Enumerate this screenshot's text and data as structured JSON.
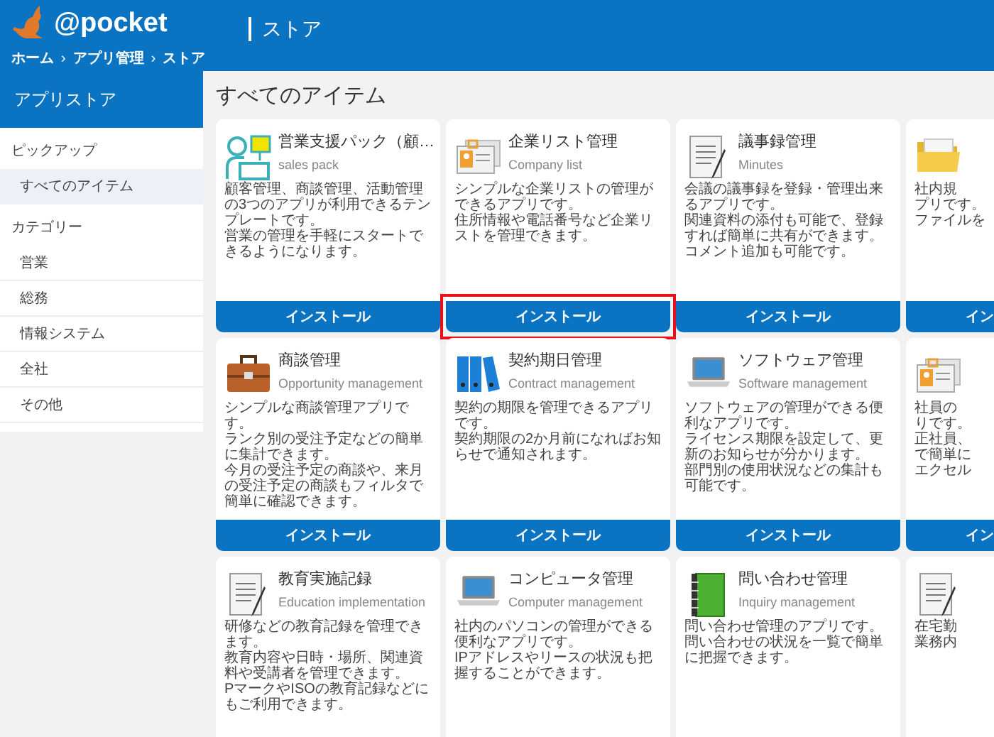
{
  "header": {
    "logo": "@pocket",
    "title": "ストア",
    "breadcrumb": [
      "ホーム",
      "›",
      "アプリ管理",
      "›",
      "ストア"
    ]
  },
  "sidebar": {
    "title": "アプリストア",
    "sections": [
      {
        "heading": "ピックアップ",
        "items": [
          {
            "label": "すべてのアイテム",
            "selected": true
          }
        ]
      },
      {
        "heading": "カテゴリー",
        "items": [
          {
            "label": "営業",
            "selected": false
          },
          {
            "label": "総務",
            "selected": false
          },
          {
            "label": "情報システム",
            "selected": false
          },
          {
            "label": "全社",
            "selected": false
          },
          {
            "label": "その他",
            "selected": false
          }
        ]
      }
    ]
  },
  "main": {
    "title": "すべてのアイテム",
    "cards": [
      {
        "title": "営業支援パック（顧…",
        "subtitle": "sales pack",
        "description": [
          "顧客管理、商談管理、活動管理の3つのアプリが利用できるテンプレートです。",
          "営業の管理を手軽にスタートできるようになります。"
        ],
        "button": {
          "label": "インストール",
          "highlighted": false
        }
      },
      {
        "title": "企業リスト管理",
        "subtitle": "Company list",
        "description": [
          "シンプルな企業リストの管理ができるアプリです。",
          "住所情報や電話番号など企業リストを管理できます。"
        ],
        "button": {
          "label": "インストール",
          "highlighted": true
        }
      },
      {
        "title": "議事録管理",
        "subtitle": "Minutes",
        "description": [
          "会議の議事録を登録・管理出来るアプリです。",
          "関連資料の添付も可能で、登録すれば簡単に共有ができます。",
          "コメント追加も可能です。"
        ],
        "button": {
          "label": "インストール",
          "highlighted": false
        }
      },
      {
        "description": [
          "社内規",
          "プリです。",
          "ファイルを"
        ],
        "button": {
          "label": "イン",
          "highlighted": false
        }
      },
      {
        "title": "商談管理",
        "subtitle": "Opportunity management",
        "description": [
          "シンプルな商談管理アプリです。",
          "ランク別の受注予定などの簡単に集計できます。",
          "今月の受注予定の商談や、来月の受注予定の商談もフィルタで簡単に確認できます。"
        ],
        "button": {
          "label": "インストール",
          "highlighted": false
        }
      },
      {
        "title": "契約期日管理",
        "subtitle": "Contract management",
        "description": [
          "契約の期限を管理できるアプリです。",
          "契約期限の2か月前になればお知らせで通知されます。"
        ],
        "button": {
          "label": "インストール",
          "highlighted": false
        }
      },
      {
        "title": "ソフトウェア管理",
        "subtitle": "Software management",
        "description": [
          "ソフトウェアの管理ができる便利なアプリです。",
          "ライセンス期限を設定して、更新のお知らせが分かります。",
          "部門別の使用状況などの集計も可能です。"
        ],
        "button": {
          "label": "インストール",
          "highlighted": false
        }
      },
      {
        "description": [
          "社員の",
          "りです。",
          "正社員、",
          "で簡単に",
          "エクセル"
        ],
        "button": {
          "label": "イン",
          "highlighted": false
        }
      },
      {
        "title": "教育実施記録",
        "subtitle": "Education implementation",
        "description": [
          "研修などの教育記録を管理できます。",
          "教育内容や日時・場所、関連資料や受講者を管理できます。",
          "PマークやISOの教育記録などにもご利用できます。"
        ]
      },
      {
        "title": "コンピュータ管理",
        "subtitle": "Computer management",
        "description": [
          "社内のパソコンの管理ができる便利なアプリです。",
          "IPアドレスやリースの状況も把握することができます。"
        ]
      },
      {
        "title": "問い合わせ管理",
        "subtitle": "Inquiry management",
        "description": [
          "問い合わせ管理のアプリです。",
          "問い合わせの状況を一覧で簡単に把握できます。"
        ]
      },
      {
        "description": [
          "在宅勤",
          "業務内"
        ]
      }
    ]
  }
}
